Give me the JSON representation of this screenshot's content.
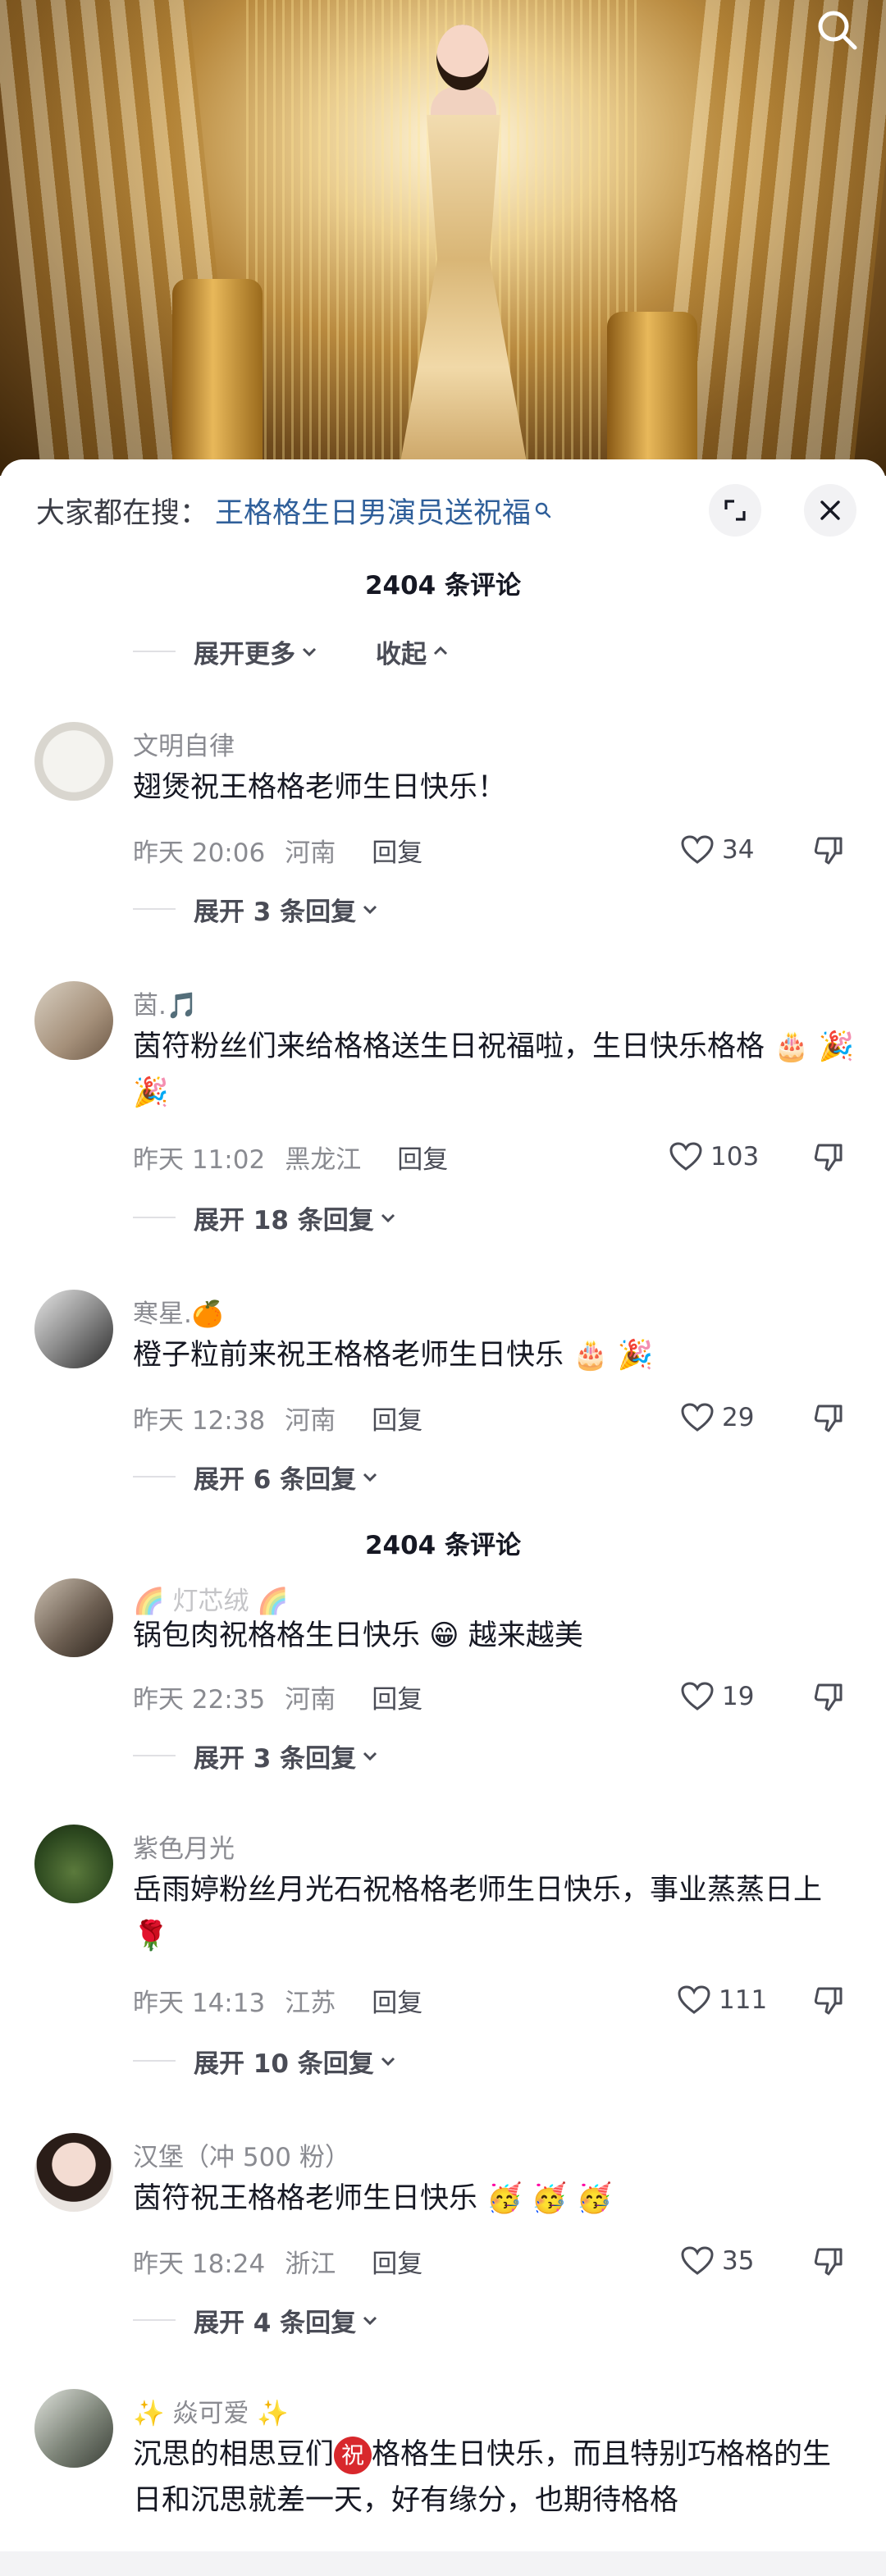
{
  "header": {
    "hot_search_prefix": "大家都在搜：",
    "hot_search_query": "王格格生日男演员送祝福",
    "search_icon": "magnifier-icon",
    "expand_icon": "expand-icon",
    "close_icon": "close-icon"
  },
  "comments_count_label": "2404 条评论",
  "fold_controls": {
    "expand_more": "展开更多",
    "collapse": "收起"
  },
  "comments": [
    {
      "author": "文明自律",
      "text": "翅煲祝王格格老师生日快乐！",
      "time": "昨天 20:06",
      "location": "河南",
      "reply": "回复",
      "likes": "34",
      "expand": "展开 3 条回复"
    },
    {
      "author": "茵.🎵",
      "text": "茵符粉丝们来给格格送生日祝福啦，生日快乐格格 🎂 🎉 🎉",
      "time": "昨天 11:02",
      "location": "黑龙江",
      "reply": "回复",
      "likes": "103",
      "expand": "展开 18 条回复"
    },
    {
      "author": "寒星.🍊",
      "text": "橙子粒前来祝王格格老师生日快乐 🎂 🎉",
      "time": "昨天 12:38",
      "location": "河南",
      "reply": "回复",
      "likes": "29",
      "expand": "展开 6 条回复"
    },
    {
      "author": "🌈 灯芯绒 🌈",
      "text": "锅包肉祝格格生日快乐 😁 越来越美",
      "time": "昨天 22:35",
      "location": "河南",
      "reply": "回复",
      "likes": "19",
      "expand": "展开 3 条回复"
    },
    {
      "author": "紫色月光",
      "text": "岳雨婷粉丝月光石祝格格老师生日快乐，事业蒸蒸日上 🌹",
      "time": "昨天 14:13",
      "location": "江苏",
      "reply": "回复",
      "likes": "111",
      "expand": "展开 10 条回复"
    },
    {
      "author": "汉堡（冲 500 粉）",
      "text": "茵符祝王格格老师生日快乐 🥳 🥳 🥳",
      "time": "昨天 18:24",
      "location": "浙江",
      "reply": "回复",
      "likes": "35",
      "expand": "展开 4 条回复"
    },
    {
      "author": "✨ 焱可爱 ✨",
      "text_before": "沉思的相思豆们",
      "chip": "祝",
      "text_after": "格格生日快乐，而且特别巧格格的生日和沉思就差一天，好有缘分，也期待格格"
    }
  ],
  "colors": {
    "link": "#2f5f9a",
    "meta": "#8a8b91",
    "text": "#161823",
    "chip": "#d8282c"
  }
}
